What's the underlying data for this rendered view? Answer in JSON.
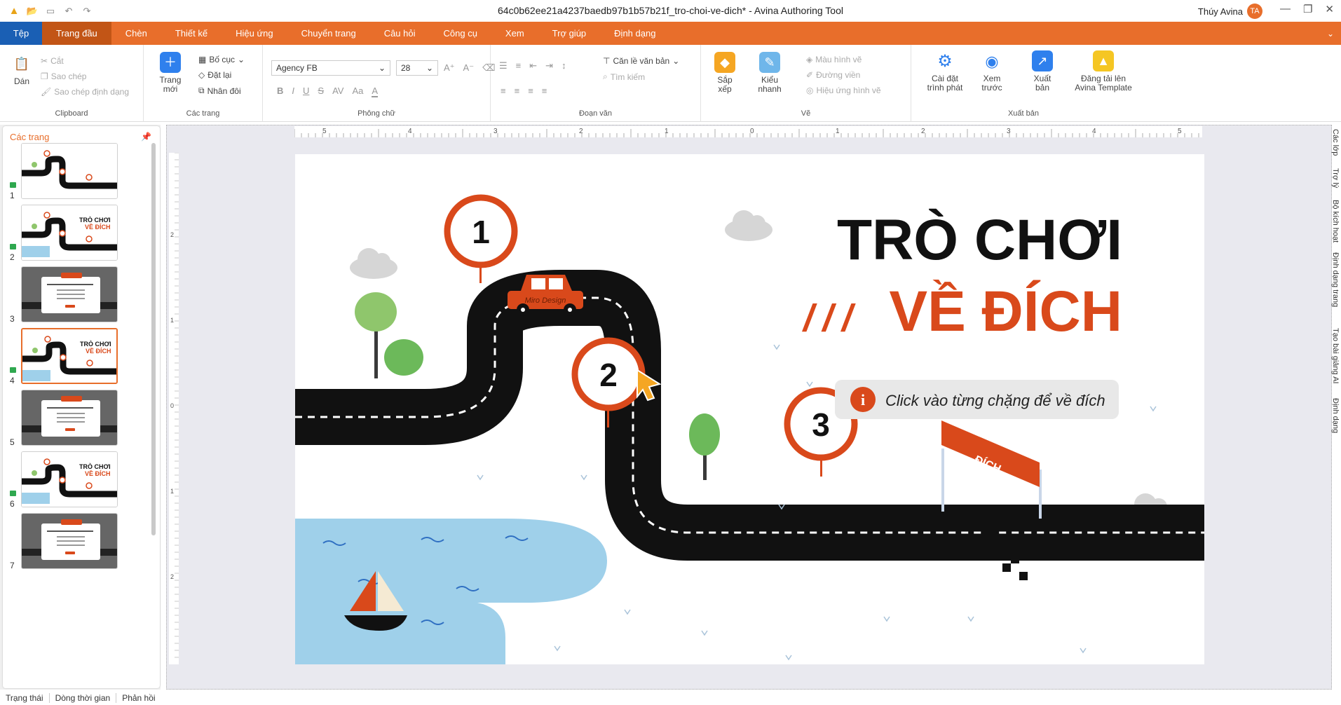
{
  "titlebar": {
    "title": "64c0b62ee21a4237baedb97b1b57b21f_tro-choi-ve-dich* - Avina Authoring Tool",
    "user_name": "Thúy Avina",
    "user_initials": "TA"
  },
  "menu": [
    "Tệp",
    "Trang đầu",
    "Chèn",
    "Thiết kế",
    "Hiệu ứng",
    "Chuyển trang",
    "Câu hỏi",
    "Công cụ",
    "Xem",
    "Trợ giúp",
    "Định dạng"
  ],
  "ribbon": {
    "clipboard": {
      "paste": "Dán",
      "cut": "Cắt",
      "copy": "Sao chép",
      "copy_format": "Sao chép định dạng",
      "label": "Clipboard"
    },
    "pages": {
      "new": "Trang mới",
      "layout": "Bố cục",
      "reset": "Đặt lại",
      "duplicate": "Nhân đôi",
      "label": "Các trang"
    },
    "font": {
      "family": "Agency FB",
      "size": "28",
      "label": "Phông chữ"
    },
    "paragraph": {
      "align_text": "Căn lề văn bản",
      "find": "Tìm kiếm",
      "label": "Đoạn văn"
    },
    "draw": {
      "arrange": "Sắp xếp",
      "quick_style": "Kiểu nhanh",
      "shape_color": "Màu hình vẽ",
      "outline": "Đường viền",
      "shape_effect": "Hiệu ứng hình vẽ",
      "label": "Vẽ"
    },
    "publish": {
      "player_settings": "Cài đặt trình phát",
      "preview": "Xem trước",
      "export": "Xuất bản",
      "upload": "Đăng tải lên Avina Template",
      "label": "Xuất bản"
    }
  },
  "pages_panel": {
    "title": "Các trang",
    "thumbs": [
      {
        "num": "1",
        "type": "road"
      },
      {
        "num": "2",
        "type": "title"
      },
      {
        "num": "3",
        "type": "question"
      },
      {
        "num": "4",
        "type": "title"
      },
      {
        "num": "5",
        "type": "question"
      },
      {
        "num": "6",
        "type": "title"
      },
      {
        "num": "7",
        "type": "question"
      }
    ],
    "selected": "4"
  },
  "slide": {
    "title_line1": "TRÒ CHƠI",
    "title_prefix": "///",
    "title_line2": "VỀ ĐÍCH",
    "instruction": "Click vào từng chặng để về đích",
    "info_icon": "i",
    "marker1": "1",
    "marker2": "2",
    "marker3": "3",
    "car_text": "Miro Design",
    "flag_text": "ĐÍCH",
    "colors": {
      "accent": "#d9491b",
      "road": "#111111",
      "water": "#9fd0ea",
      "tree": "#8fc66c"
    }
  },
  "ruler": {
    "h_labels": [
      "5",
      "4",
      "3",
      "2",
      "1",
      "0",
      "1",
      "2",
      "3",
      "4",
      "5"
    ],
    "v_labels": [
      "2",
      "1",
      "0",
      "1",
      "2"
    ]
  },
  "right_tabs": [
    "Các lớp",
    "Trợ lý",
    "Bộ kích hoạt",
    "Định dạng trang",
    "Tạo bài giảng AI",
    "Định dạng"
  ],
  "status": [
    "Trạng thái",
    "Dòng thời gian",
    "Phản hồi"
  ]
}
